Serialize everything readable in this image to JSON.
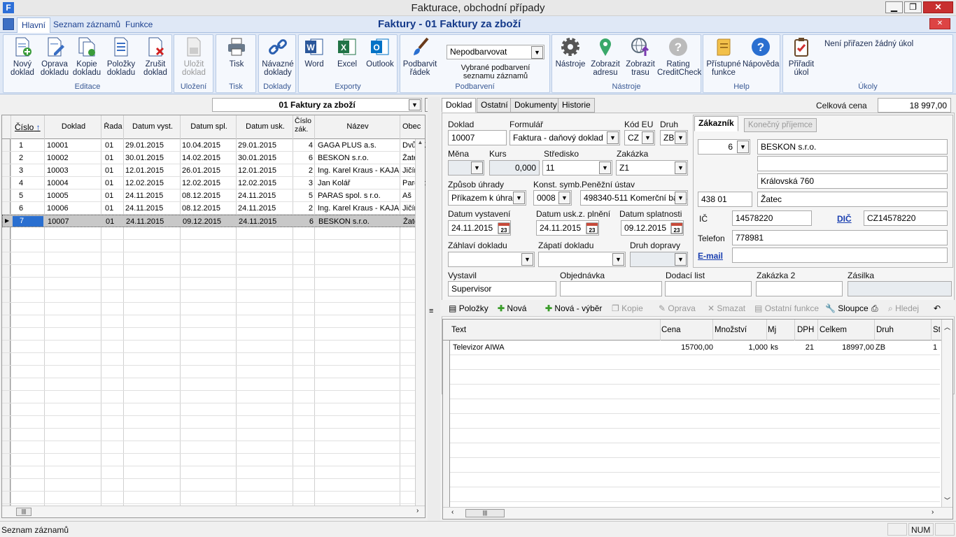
{
  "window": {
    "title": "Fakturace, obchodní případy",
    "icon_letter": "F"
  },
  "ribbon_tabs": [
    "Hlavní",
    "Seznam záznamů",
    "Funkce"
  ],
  "doc_title": "Faktury - 01 Faktury za zboží",
  "ribbon": {
    "editace": {
      "label": "Editace",
      "novy": "Nový doklad",
      "oprava": "Oprava dokladu",
      "kopie": "Kopie dokladu",
      "polozky": "Položky dokladu",
      "zrusit": "Zrušit doklad"
    },
    "ulozeni": {
      "label": "Uložení",
      "ulozit": "Uložit doklad"
    },
    "tisk": {
      "label": "Tisk",
      "tisk": "Tisk"
    },
    "doklady": {
      "label": "Doklady",
      "navazne": "Návazné doklady"
    },
    "exporty": {
      "label": "Exporty",
      "word": "Word",
      "excel": "Excel",
      "outlook": "Outlook"
    },
    "podbarveni": {
      "label": "Podbarvení",
      "podbarvit": "Podbarvit řádek",
      "select": "Nepodbarvovat",
      "vybrane": "Vybrané podbarvení seznamu záznamů"
    },
    "nastroje": {
      "label": "Nástroje",
      "nastroje": "Nástroje",
      "adresa": "Zobrazit adresu",
      "trasa": "Zobrazit trasu",
      "rating": "Rating CreditCheck"
    },
    "help": {
      "label": "Help",
      "pristupne": "Přístupné funkce",
      "napoveda": "Nápověda"
    },
    "ukoly": {
      "label": "Úkoly",
      "priradit": "Přiřadit úkol",
      "zadny": "Není přiřazen žádný úkol"
    }
  },
  "list": {
    "filter": "01 Faktury za zboží",
    "columns": [
      "Číslo",
      "Doklad",
      "Řada",
      "Datum vyst.",
      "Datum spl.",
      "Datum usk.",
      "Číslo zák.",
      "Název",
      "Obec"
    ],
    "rows": [
      [
        "1",
        "10001",
        "01",
        "29.01.2015",
        "10.04.2015",
        "29.01.2015",
        "4",
        "GAGA PLUS a.s.",
        "Dvůr Kr"
      ],
      [
        "2",
        "10002",
        "01",
        "30.01.2015",
        "14.02.2015",
        "30.01.2015",
        "6",
        "BESKON s.r.o.",
        "Žatec"
      ],
      [
        "3",
        "10003",
        "01",
        "12.01.2015",
        "26.01.2015",
        "12.01.2015",
        "2",
        "Ing. Karel Kraus - KAJAK",
        "Jičín"
      ],
      [
        "4",
        "10004",
        "01",
        "12.02.2015",
        "12.02.2015",
        "12.02.2015",
        "3",
        "Jan Kolář",
        "Pardubi"
      ],
      [
        "5",
        "10005",
        "01",
        "24.11.2015",
        "08.12.2015",
        "24.11.2015",
        "5",
        "PARAS spol. s r.o.",
        "Aš"
      ],
      [
        "6",
        "10006",
        "01",
        "24.11.2015",
        "08.12.2015",
        "24.11.2015",
        "2",
        "Ing. Karel Kraus - KAJAK",
        "Jičín"
      ],
      [
        "7",
        "10007",
        "01",
        "24.11.2015",
        "09.12.2015",
        "24.11.2015",
        "6",
        "BESKON s.r.o.",
        "Žatec"
      ]
    ]
  },
  "detail_tabs": [
    "Doklad",
    "Ostatní",
    "Dokumenty",
    "Historie"
  ],
  "celkova_cena": {
    "label": "Celková cena",
    "value": "18 997,00"
  },
  "form": {
    "doklad": {
      "label": "Doklad",
      "value": "10007"
    },
    "formular": {
      "label": "Formulář",
      "value": "Faktura - daňový doklad"
    },
    "kod_eu": {
      "label": "Kód EU",
      "value": "CZ"
    },
    "druh": {
      "label": "Druh",
      "value": "ZB"
    },
    "mena": {
      "label": "Měna",
      "value": ""
    },
    "kurs": {
      "label": "Kurs",
      "value": "0,000"
    },
    "stredisko": {
      "label": "Středisko",
      "value": "11"
    },
    "zakazka": {
      "label": "Zakázka",
      "value": "Z1"
    },
    "zpusob": {
      "label": "Způsob úhrady",
      "value": "Příkazem k úhradě"
    },
    "konst": {
      "label": "Konst. symb.",
      "value": "0008"
    },
    "penezni": {
      "label": "Peněžní ústav",
      "value": "498340-511 Komerční banka"
    },
    "dat_vyst": {
      "label": "Datum vystavení",
      "value": "24.11.2015"
    },
    "dat_usk": {
      "label": "Datum usk.z. plnění",
      "value": "24.11.2015"
    },
    "dat_spl": {
      "label": "Datum splatnosti",
      "value": "09.12.2015"
    },
    "zahlavi": {
      "label": "Záhlaví dokladu",
      "value": ""
    },
    "zapati": {
      "label": "Zápatí dokladu",
      "value": ""
    },
    "druh_dopravy": {
      "label": "Druh dopravy",
      "value": ""
    },
    "vystavil": {
      "label": "Vystavil",
      "value": "Supervisor"
    },
    "objednavka": {
      "label": "Objednávka",
      "value": ""
    },
    "dodaci": {
      "label": "Dodací list",
      "value": ""
    },
    "zakazka2": {
      "label": "Zakázka 2",
      "value": ""
    },
    "zasilka": {
      "label": "Zásilka",
      "value": ""
    }
  },
  "customer": {
    "tab_active": "Zákazník",
    "tab_other": "Konečný příjemce",
    "number": "6",
    "name": "BESKON s.r.o.",
    "line2": "",
    "street": "Královská 760",
    "zip": "438 01",
    "city": "Žatec",
    "ic_label": "IČ",
    "ic": "14578220",
    "dic_label": "DIČ",
    "dic": "CZ14578220",
    "tel_label": "Telefon",
    "tel": "778981",
    "email_label": "E-mail",
    "email": ""
  },
  "items_toolbar": {
    "polozky": "Položky",
    "nova": "Nová",
    "nova_vyber": "Nová - výběr",
    "kopie": "Kopie",
    "oprava": "Oprava",
    "smazat": "Smazat",
    "ostatni": "Ostatní funkce",
    "sloupce": "Sloupce",
    "hledej": "Hledej"
  },
  "items": {
    "columns": [
      "Text",
      "Cena",
      "Množství",
      "Mj",
      "DPH",
      "Celkem",
      "Druh",
      "St"
    ],
    "rows": [
      [
        "Televizor AIWA",
        "15700,00",
        "1,000",
        "ks",
        "21",
        "18997,00",
        "ZB",
        "1"
      ]
    ]
  },
  "status": {
    "left": "Seznam záznamů",
    "num": "NUM"
  }
}
